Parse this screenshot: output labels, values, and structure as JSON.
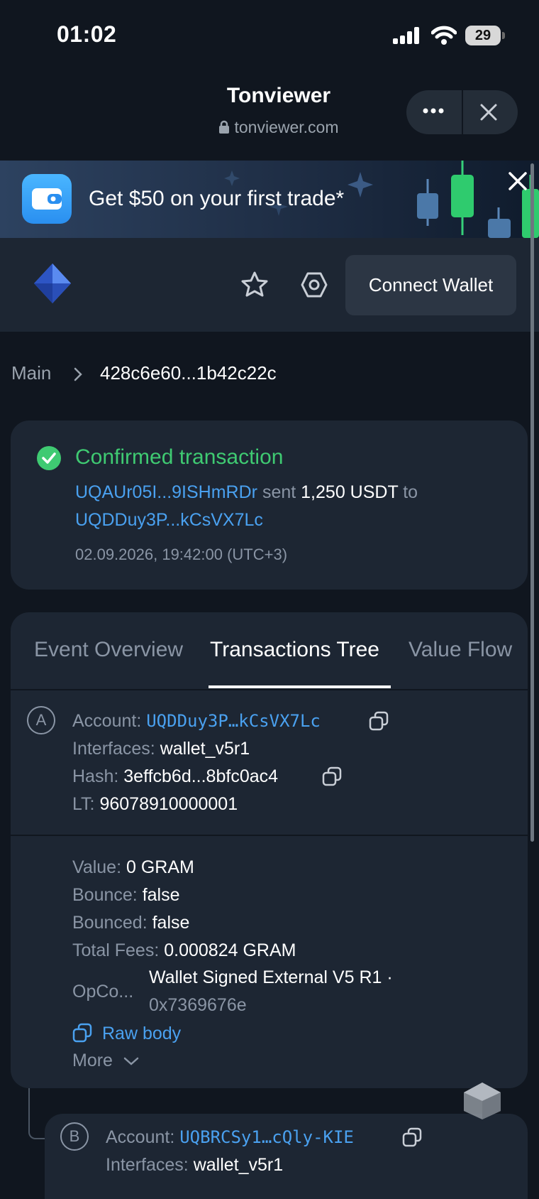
{
  "status_bar": {
    "time": "01:02",
    "battery": "29"
  },
  "browser": {
    "title": "Tonviewer",
    "url": "tonviewer.com"
  },
  "promo": {
    "text": "Get $50 on your first trade*"
  },
  "header": {
    "connect_label": "Connect Wallet"
  },
  "breadcrumb": {
    "root": "Main",
    "separator": "›",
    "current": "428c6e60...1b42c22c"
  },
  "summary": {
    "status": "Confirmed transaction",
    "from": "UQAUr05I...9ISHmRDr",
    "verb": "sent",
    "amount": "1,250 USDT",
    "to_word": "to",
    "to": "UQDDuy3P...kCsVX7Lc",
    "timestamp": "02.09.2026, 19:42:00 (UTC+3)"
  },
  "tabs": [
    "Event Overview",
    "Transactions Tree",
    "Value Flow"
  ],
  "node_a": {
    "label": "A",
    "account_label": "Account:",
    "account": "UQDDuy3P…kCsVX7Lc",
    "interfaces_label": "Interfaces:",
    "interfaces": "wallet_v5r1",
    "hash_label": "Hash:",
    "hash": "3effcb6d...8bfc0ac4",
    "lt_label": "LT:",
    "lt": "96078910000001",
    "value_label": "Value:",
    "value": "0 GRAM",
    "bounce_label": "Bounce:",
    "bounce": "false",
    "bounced_label": "Bounced:",
    "bounced": "false",
    "fees_label": "Total Fees:",
    "fees": "0.000824 GRAM",
    "opcode_label": "OpCo...",
    "opcode_name": "Wallet Signed External V5 R1 ·",
    "opcode_hex": "0x7369676e",
    "raw_body": "Raw body",
    "more": "More"
  },
  "node_b": {
    "label": "B",
    "account_label": "Account:",
    "account": "UQBRCSy1…cQly-KIE",
    "interfaces_label": "Interfaces:",
    "interfaces": "wallet_v5r1"
  },
  "colors": {
    "accent": "#4aa1f0",
    "success": "#3fca72",
    "card": "#1d2633",
    "background": "#10161f"
  }
}
